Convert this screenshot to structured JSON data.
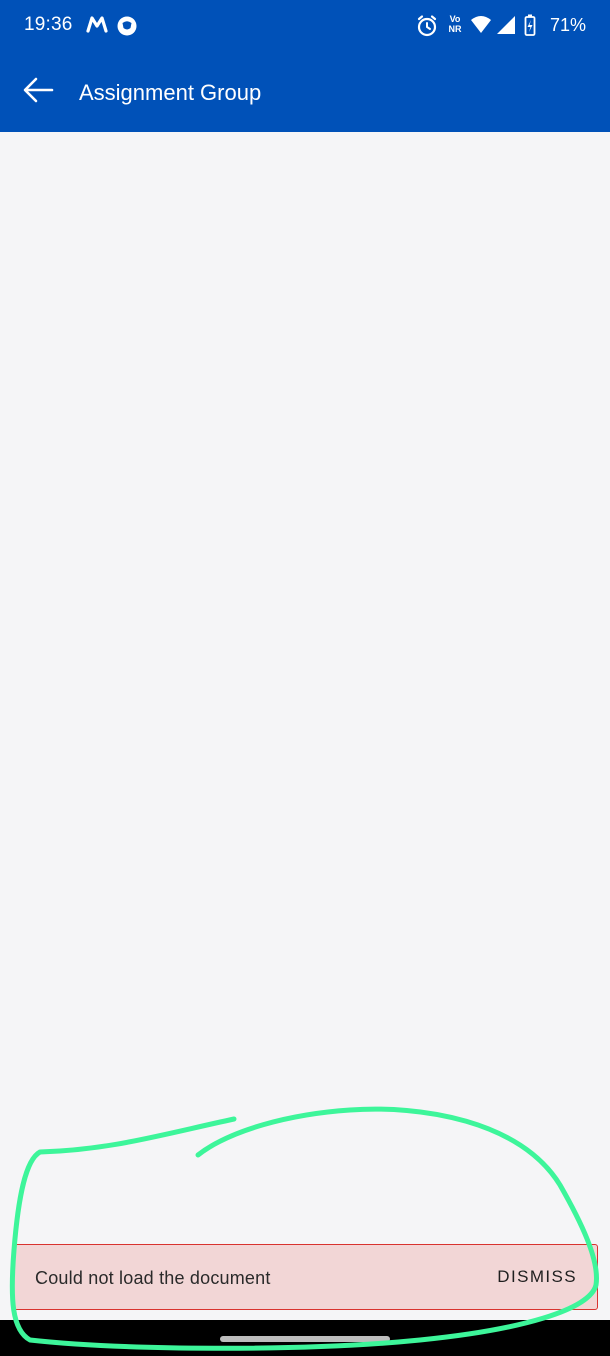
{
  "status_bar": {
    "time": "19:36",
    "battery": "71%",
    "left_icons": [
      "myntra-m-icon",
      "chat-bubble-icon"
    ],
    "right_icons": [
      "alarm-icon",
      "vonr-icon",
      "wifi-icon",
      "signal-icon",
      "battery-charging-icon"
    ],
    "vonr_top": "Vo",
    "vonr_bottom": "NR"
  },
  "app_bar": {
    "title": "Assignment Group",
    "back_icon": "arrow-left-icon"
  },
  "snackbar": {
    "message": "Could not load the document",
    "action_label": "DISMISS"
  },
  "colors": {
    "primary": "#0051b8",
    "background": "#f5f5f7",
    "snackbar_bg": "#f2d6d6",
    "snackbar_border": "#d9332f",
    "annotation": "#3df59a"
  }
}
